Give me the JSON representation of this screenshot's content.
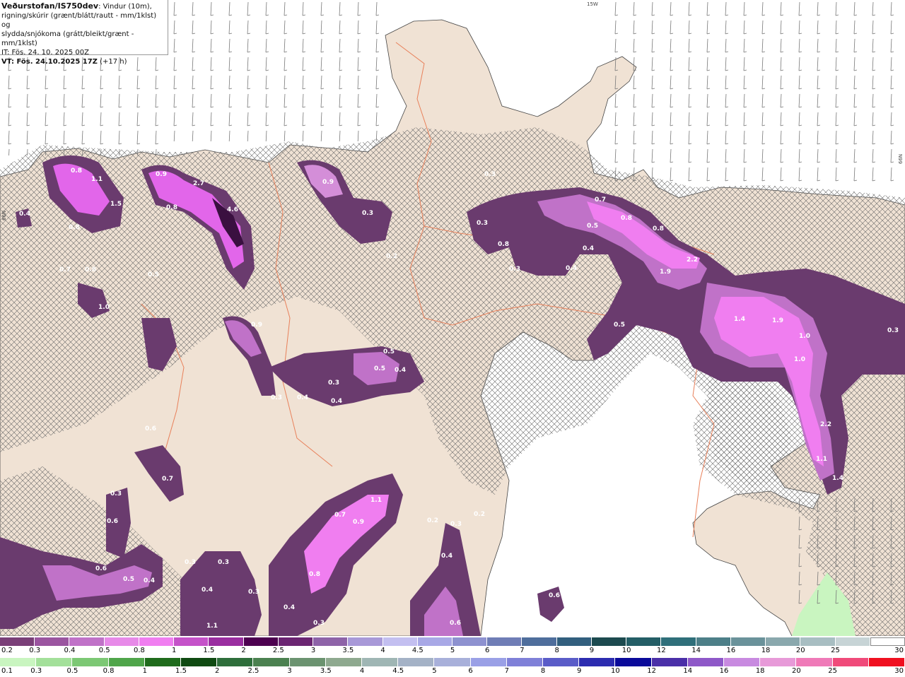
{
  "header": {
    "brand": "Veðurstofan/IS750dev",
    "desc_1": ": Vindur (10m),",
    "desc_2": "rigning/skúrir (grænt/blátt/rautt - mm/1klst) og",
    "desc_3": "slydda/snjókoma (grátt/bleikt/grænt - mm/1klst)",
    "it": "IT: Fös. 24. 10. 2025 00Z",
    "vt": "VT: Fös. 24.10.2025 17Z",
    "vt_offset": "(+17 h)"
  },
  "edge_labels": [
    "15W",
    "66N",
    "66N"
  ],
  "map_labels": [
    {
      "t": "0.8"
    },
    {
      "t": "1.1"
    },
    {
      "t": "1.5"
    },
    {
      "t": "0.4"
    },
    {
      "t": "0.8"
    },
    {
      "t": "0.7"
    },
    {
      "t": "0.8"
    },
    {
      "t": "1.0"
    },
    {
      "t": "0.9"
    },
    {
      "t": "2.7"
    },
    {
      "t": "0.8"
    },
    {
      "t": "4.6"
    },
    {
      "t": "0.5"
    },
    {
      "t": "0.9"
    },
    {
      "t": "0.3"
    },
    {
      "t": "0.2"
    },
    {
      "t": "0.3"
    },
    {
      "t": "0.9"
    },
    {
      "t": "0.3"
    },
    {
      "t": "0.4"
    },
    {
      "t": "0.5"
    },
    {
      "t": "0.5"
    },
    {
      "t": "0.4"
    },
    {
      "t": "0.3"
    },
    {
      "t": "0.4"
    },
    {
      "t": "0.8"
    },
    {
      "t": "0.3"
    },
    {
      "t": "0.5"
    },
    {
      "t": "0.7"
    },
    {
      "t": "0.8"
    },
    {
      "t": "0.8"
    },
    {
      "t": "0.4"
    },
    {
      "t": "0.4"
    },
    {
      "t": "1.9"
    },
    {
      "t": "2.2"
    },
    {
      "t": "0.5"
    },
    {
      "t": "1.4"
    },
    {
      "t": "1.9"
    },
    {
      "t": "1.0"
    },
    {
      "t": "1.0"
    },
    {
      "t": "2.2"
    },
    {
      "t": "1.1"
    },
    {
      "t": "1.4"
    },
    {
      "t": "0.3"
    },
    {
      "t": "0.7"
    },
    {
      "t": "0.6"
    },
    {
      "t": "0.3"
    },
    {
      "t": "0.6"
    },
    {
      "t": "0.6"
    },
    {
      "t": "0.5"
    },
    {
      "t": "0.4"
    },
    {
      "t": "0.3"
    },
    {
      "t": "0.3"
    },
    {
      "t": "0.4"
    },
    {
      "t": "0.3"
    },
    {
      "t": "1.1"
    },
    {
      "t": "1.1"
    },
    {
      "t": "0.7"
    },
    {
      "t": "0.9"
    },
    {
      "t": "0.8"
    },
    {
      "t": "0.4"
    },
    {
      "t": "0.3"
    },
    {
      "t": "0.2"
    },
    {
      "t": "0.3"
    },
    {
      "t": "0.2"
    },
    {
      "t": "0.4"
    },
    {
      "t": "0.6"
    },
    {
      "t": "0.6"
    },
    {
      "t": "0.3"
    }
  ],
  "legend_snow": {
    "ticks": [
      "0.2",
      "0.3",
      "0.4",
      "0.5",
      "0.8",
      "1",
      "1.5",
      "2",
      "2.5",
      "3",
      "3.5",
      "4",
      "4.5",
      "5",
      "6",
      "7",
      "8",
      "9",
      "10",
      "12",
      "14",
      "16",
      "18",
      "20",
      "25",
      "30"
    ],
    "colors": [
      "#7a3f78",
      "#9b55a0",
      "#c072c8",
      "#e78ae8",
      "#f07ef0",
      "#c552c9",
      "#9a2ea0",
      "#4d0050",
      "#6b2572",
      "#8e63a8",
      "#a899d8",
      "#c3bff0",
      "#a8a8e6",
      "#8e92d0",
      "#6f7db6",
      "#4f6e9c",
      "#325f7e",
      "#1c4a4f",
      "#245e66",
      "#2f6f7a",
      "#4d7f88",
      "#6a929a",
      "#8aa8ad",
      "#a8bec2",
      "#c7d4d6",
      "#ffffff"
    ]
  },
  "legend_rain": {
    "ticks": [
      "0.1",
      "0.3",
      "0.5",
      "0.8",
      "1",
      "1.5",
      "2",
      "2.5",
      "3",
      "3.5",
      "4",
      "4.5",
      "5",
      "6",
      "7",
      "8",
      "9",
      "10",
      "12",
      "14",
      "16",
      "18",
      "20",
      "25",
      "30"
    ],
    "colors": [
      "#c9f5c0",
      "#a3e09a",
      "#7cc874",
      "#4fa54a",
      "#1f6b1c",
      "#0f4a12",
      "#2e6e3b",
      "#4b8150",
      "#6b9370",
      "#8ea98f",
      "#9fb6b4",
      "#a4b2c6",
      "#a8b0da",
      "#9aa0e6",
      "#7f80d8",
      "#5a5cc8",
      "#2c2cb0",
      "#0a0a9a",
      "#4a2fa8",
      "#8e58c8",
      "#c88ae0",
      "#e79ad8",
      "#ef7ab8",
      "#f04a7a",
      "#f01020"
    ]
  }
}
